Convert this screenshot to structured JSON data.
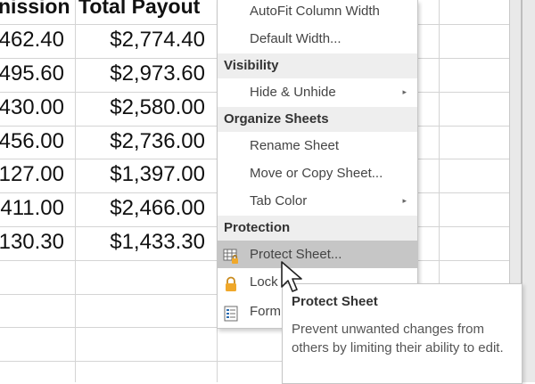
{
  "sheet": {
    "headers": [
      "nission",
      "Total Payout"
    ],
    "rows": [
      [
        "462.40",
        "$2,774.40"
      ],
      [
        "495.60",
        "$2,973.60"
      ],
      [
        "430.00",
        "$2,580.00"
      ],
      [
        "456.00",
        "$2,736.00"
      ],
      [
        "127.00",
        "$1,397.00"
      ],
      [
        "411.00",
        "$2,466.00"
      ],
      [
        "130.30",
        "$1,433.30"
      ]
    ]
  },
  "menu": {
    "items": [
      {
        "label": "AutoFit Column Width"
      },
      {
        "label": "Default Width..."
      },
      {
        "label": "Hide & Unhide"
      },
      {
        "label": "Rename Sheet"
      },
      {
        "label": "Move or Copy Sheet..."
      },
      {
        "label": "Tab Color"
      },
      {
        "label": "Protect Sheet..."
      },
      {
        "label": "Lock C"
      },
      {
        "label": "Form"
      }
    ],
    "sections": [
      "Visibility",
      "Organize Sheets",
      "Protection"
    ],
    "submenu_arrow": "▸"
  },
  "tooltip": {
    "title": "Protect Sheet",
    "body": "Prevent unwanted changes from others by limiting their ability to edit."
  },
  "icons": {
    "protect": "protect-sheet-icon",
    "lock": "lock-icon",
    "format": "format-cells-icon"
  },
  "colors": {
    "highlight": "#c6c6c6",
    "section_bg": "#eeeeee",
    "lock": "#f0a82a"
  }
}
